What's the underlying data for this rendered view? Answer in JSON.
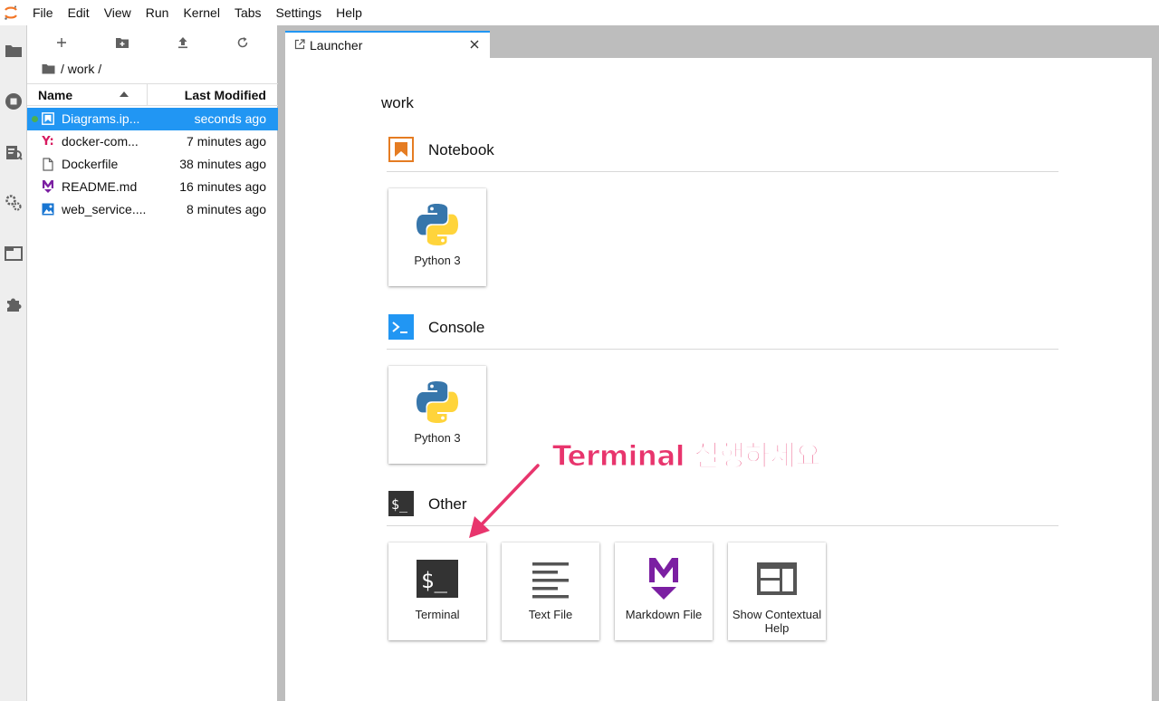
{
  "menubar": {
    "items": [
      "File",
      "Edit",
      "View",
      "Run",
      "Kernel",
      "Tabs",
      "Settings",
      "Help"
    ]
  },
  "activity": {
    "icons": [
      "folder-icon",
      "running-icon",
      "commands-icon",
      "property-inspector-icon",
      "tabs-icon",
      "extension-icon"
    ]
  },
  "filebrowser": {
    "breadcrumb": "/ work /",
    "header": {
      "name": "Name",
      "modified": "Last Modified"
    },
    "files": [
      {
        "name": "Diagrams.ipynb",
        "display": "Diagrams.ip...",
        "modified": "seconds ago",
        "icon": "notebook-icon",
        "running": true,
        "selected": true
      },
      {
        "name": "docker-compose.yml",
        "display": "docker-com...",
        "modified": "7 minutes ago",
        "icon": "yaml-icon",
        "running": false,
        "selected": false
      },
      {
        "name": "Dockerfile",
        "display": "Dockerfile",
        "modified": "38 minutes ago",
        "icon": "file-icon",
        "running": false,
        "selected": false
      },
      {
        "name": "README.md",
        "display": "README.md",
        "modified": "16 minutes ago",
        "icon": "markdown-icon",
        "running": false,
        "selected": false
      },
      {
        "name": "web_service.png",
        "display": "web_service....",
        "modified": "8 minutes ago",
        "icon": "image-icon",
        "running": false,
        "selected": false
      }
    ]
  },
  "tab": {
    "label": "Launcher"
  },
  "launcher": {
    "cwd": "work",
    "sections": {
      "notebook": {
        "title": "Notebook",
        "cards": [
          "Python 3"
        ]
      },
      "console": {
        "title": "Console",
        "cards": [
          "Python 3"
        ]
      },
      "other": {
        "title": "Other",
        "cards": [
          "Terminal",
          "Text File",
          "Markdown File",
          "Show Contextual Help"
        ]
      }
    }
  },
  "annotation": {
    "text": "Terminal 실행하세요",
    "color": "#e8356d"
  },
  "colors": {
    "accent": "#2196f3",
    "notebook": "#e57c22",
    "markdown": "#7b1fa2",
    "annotation": "#e8356d"
  }
}
